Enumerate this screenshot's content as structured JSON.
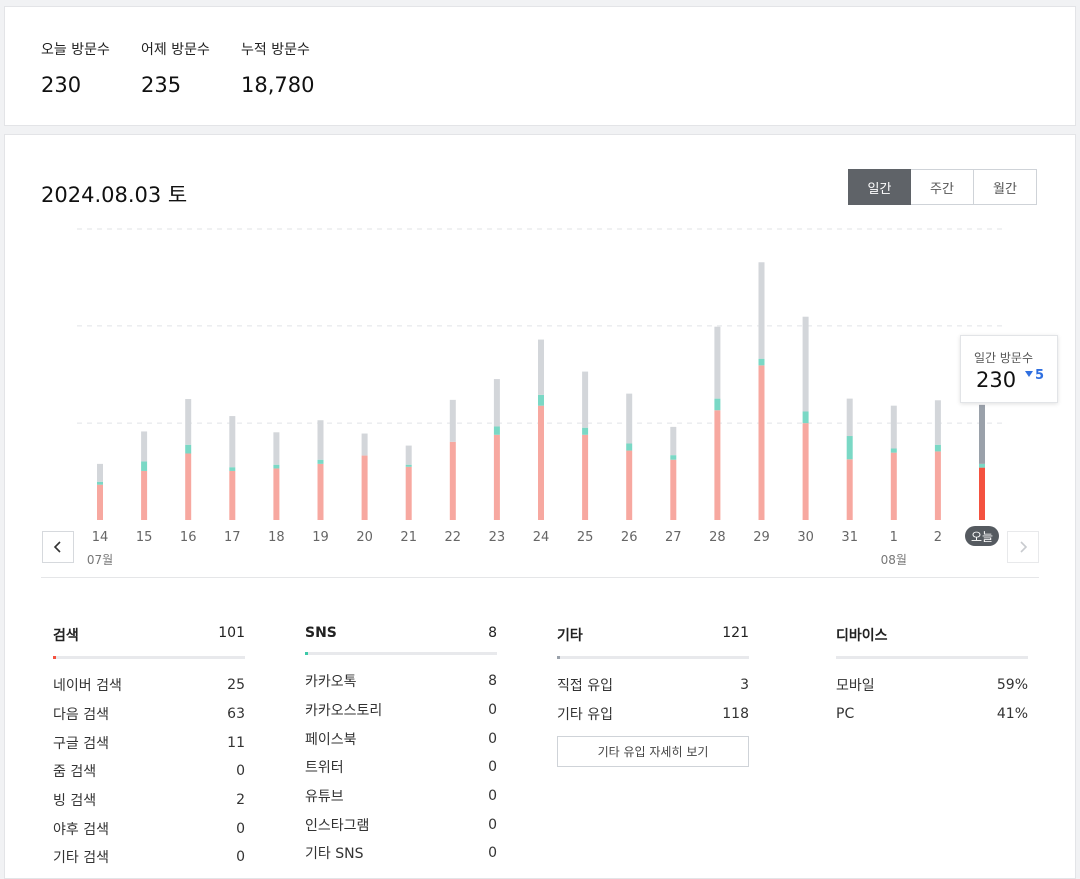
{
  "summary": {
    "today_label": "오늘 방문수",
    "today_value": "230",
    "yesterday_label": "어제 방문수",
    "yesterday_value": "235",
    "total_label": "누적 방문수",
    "total_value": "18,780"
  },
  "main": {
    "date_title": "2024.08.03 토",
    "period_tabs": [
      {
        "label": "일간",
        "active": true
      },
      {
        "label": "주간",
        "active": false
      },
      {
        "label": "월간",
        "active": false
      }
    ],
    "tooltip": {
      "label": "일간 방문수",
      "value": "230",
      "delta": "5"
    }
  },
  "chart_data": {
    "type": "bar",
    "stacked": true,
    "categories": [
      "14",
      "15",
      "16",
      "17",
      "18",
      "19",
      "20",
      "21",
      "22",
      "23",
      "24",
      "25",
      "26",
      "27",
      "28",
      "29",
      "30",
      "31",
      "1",
      "2",
      "오늘"
    ],
    "month_labels": [
      {
        "at": "14",
        "label": "07월"
      },
      {
        "at": "1",
        "label": "08월"
      }
    ],
    "series": [
      {
        "color": "#f7a8a0",
        "values": [
          85,
          118,
          160,
          118,
          124,
          135,
          155,
          128,
          188,
          205,
          275,
          205,
          167,
          145,
          264,
          372,
          233,
          146,
          162,
          165,
          126
        ]
      },
      {
        "color": "#7ad8c5",
        "values": [
          7,
          23,
          21,
          9,
          9,
          10,
          0,
          5,
          0,
          20,
          26,
          17,
          17,
          11,
          28,
          16,
          28,
          56,
          10,
          16,
          9
        ]
      },
      {
        "color": "#d3d6da",
        "values": [
          43,
          72,
          110,
          123,
          78,
          95,
          53,
          46,
          101,
          114,
          133,
          135,
          120,
          68,
          173,
          232,
          228,
          90,
          103,
          107,
          142
        ]
      }
    ],
    "today_colors": [
      "#f4523f",
      "#7ad8c5",
      "#9aa1aa"
    ],
    "ylim": [
      0,
      700
    ],
    "gridlines": [
      233,
      467,
      700
    ]
  },
  "breakdown": {
    "search": {
      "title": "검색",
      "total": "101",
      "accent": "#f4523f",
      "rows": [
        {
          "label": "네이버 검색",
          "value": "25"
        },
        {
          "label": "다음 검색",
          "value": "63"
        },
        {
          "label": "구글 검색",
          "value": "11"
        },
        {
          "label": "줌 검색",
          "value": "0"
        },
        {
          "label": "빙 검색",
          "value": "2"
        },
        {
          "label": "야후 검색",
          "value": "0"
        },
        {
          "label": "기타 검색",
          "value": "0"
        }
      ]
    },
    "sns": {
      "title": "SNS",
      "total": "8",
      "accent": "#3cc9a8",
      "rows": [
        {
          "label": "카카오톡",
          "value": "8"
        },
        {
          "label": "카카오스토리",
          "value": "0"
        },
        {
          "label": "페이스북",
          "value": "0"
        },
        {
          "label": "트위터",
          "value": "0"
        },
        {
          "label": "유튜브",
          "value": "0"
        },
        {
          "label": "인스타그램",
          "value": "0"
        },
        {
          "label": "기타 SNS",
          "value": "0"
        }
      ]
    },
    "other": {
      "title": "기타",
      "total": "121",
      "accent": "#9aa1aa",
      "rows": [
        {
          "label": "직접 유입",
          "value": "3"
        },
        {
          "label": "기타 유입",
          "value": "118"
        }
      ],
      "more_button": "기타 유입 자세히 보기"
    },
    "device": {
      "title": "디바이스",
      "rows": [
        {
          "label": "모바일",
          "value": "59%"
        },
        {
          "label": "PC",
          "value": "41%"
        }
      ]
    }
  },
  "icons": {
    "prev": "chevron-left-icon",
    "next": "chevron-right-icon",
    "delta": "triangle-down-icon"
  }
}
